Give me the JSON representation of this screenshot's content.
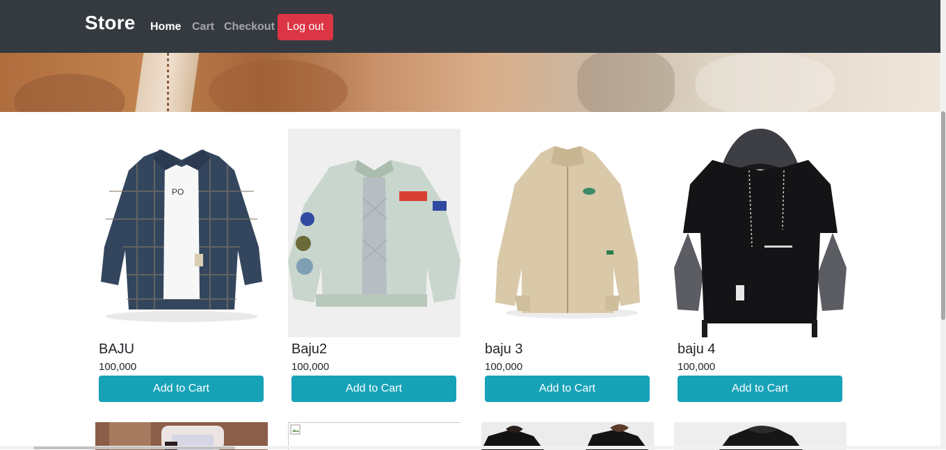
{
  "navbar": {
    "brand": "Store",
    "links": [
      "Home",
      "Cart",
      "Checkout"
    ],
    "active": "Home",
    "logout_label": "Log out"
  },
  "products": [
    {
      "name": "BAJU",
      "price": "100,000",
      "button": "Add to Cart"
    },
    {
      "name": "Baju2",
      "price": "100,000",
      "button": "Add to Cart"
    },
    {
      "name": "baju 3",
      "price": "100,000",
      "button": "Add to Cart"
    },
    {
      "name": "baju 4",
      "price": "100,000",
      "button": "Add to Cart"
    }
  ],
  "colors": {
    "navbar_bg": "#343a40",
    "logout_bg": "#dc3545",
    "add_to_cart_bg": "#17a2b8"
  }
}
